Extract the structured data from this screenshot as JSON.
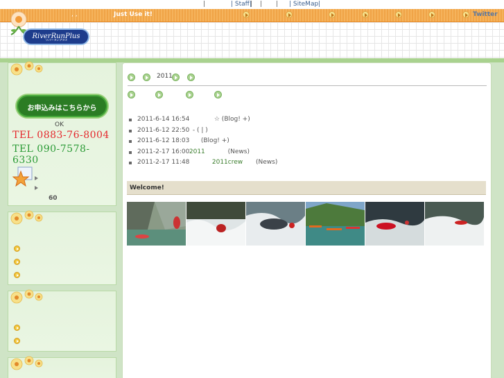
{
  "topnav": {
    "separator": "|",
    "staff_label": "| Staff|",
    "sitemap_label": "| SiteMap|"
  },
  "orangebar": {
    "dots": ",    ,",
    "slogan": "Just Use it!",
    "twitter_label": "Twitter"
  },
  "logo": {
    "name": "RiverRunPlus",
    "sub": "リバーランプラス"
  },
  "sidebar": {
    "apply_button": "お申込みはこちらから",
    "ok_text": "OK",
    "tel1": "TEL 0883-76-8004",
    "tel2": "TEL 090-7578-6330",
    "number": "60"
  },
  "main": {
    "breadcrumb_year": "2011",
    "news": [
      {
        "date": "2011-6-14 16:54",
        "text": "☆ (Blog!    +)",
        "link": ""
      },
      {
        "date": "2011-6-12 22:50",
        "text": "-               (      |  )",
        "link": ""
      },
      {
        "date": "2011-6-12 18:03",
        "text": "(Blog!    +)",
        "link": ""
      },
      {
        "date": "2011-2-17 16:00",
        "text": "(News)",
        "link": "2011"
      },
      {
        "date": "2011-2-17 11:48",
        "text": "(News)",
        "link": "2011crew"
      }
    ],
    "welcome": "Welcome!"
  },
  "colors": {
    "orange": "#f0a447",
    "green_bg": "#cfe4c6",
    "tel_red": "#e5262b",
    "tel_green": "#2a9a35"
  }
}
